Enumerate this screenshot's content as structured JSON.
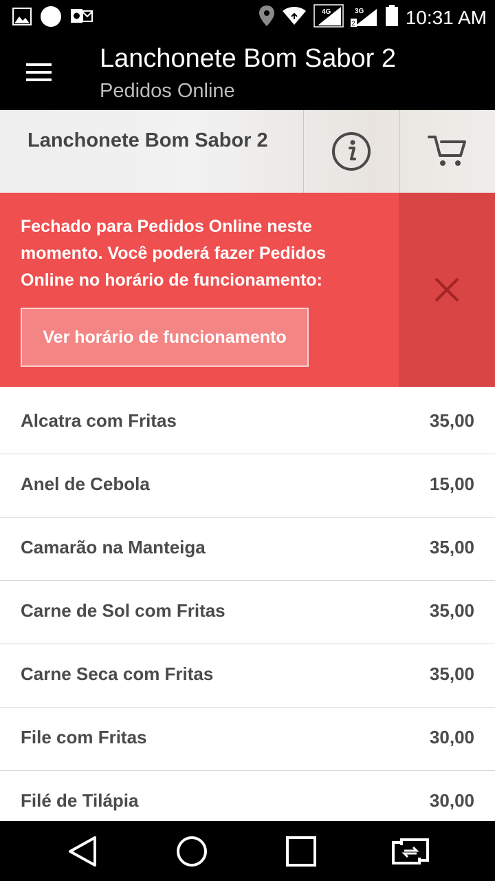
{
  "status_bar": {
    "time": "10:31 AM",
    "icons": [
      "image-icon",
      "circle-icon",
      "outlook-icon",
      "location-icon",
      "wifi-icon",
      "signal-4g-icon",
      "signal-3g-icon",
      "battery-icon"
    ],
    "network_4g": "4G",
    "network_3g": "3G"
  },
  "app_bar": {
    "title": "Lanchonete Bom Sabor 2",
    "subtitle": "Pedidos Online"
  },
  "store_header": {
    "name": "Lanchonete Bom Sabor 2"
  },
  "banner": {
    "message": "Fechado para Pedidos Online neste momento. Você poderá fazer Pedidos Online no horário de funcionamento:",
    "button_label": "Ver horário de funcionamento"
  },
  "menu": {
    "items": [
      {
        "name": "Alcatra com Fritas",
        "price": "35,00"
      },
      {
        "name": "Anel de Cebola",
        "price": "15,00"
      },
      {
        "name": "Camarão na Manteiga",
        "price": "35,00"
      },
      {
        "name": "Carne de Sol com Fritas",
        "price": "35,00"
      },
      {
        "name": "Carne Seca com Fritas",
        "price": "35,00"
      },
      {
        "name": "File com Fritas",
        "price": "30,00"
      },
      {
        "name": "Filé de Tilápia",
        "price": "30,00"
      }
    ]
  },
  "colors": {
    "banner": "#ef4f4f",
    "banner_close": "#d94545",
    "bars": "#000000",
    "text": "#4b4b4b"
  }
}
